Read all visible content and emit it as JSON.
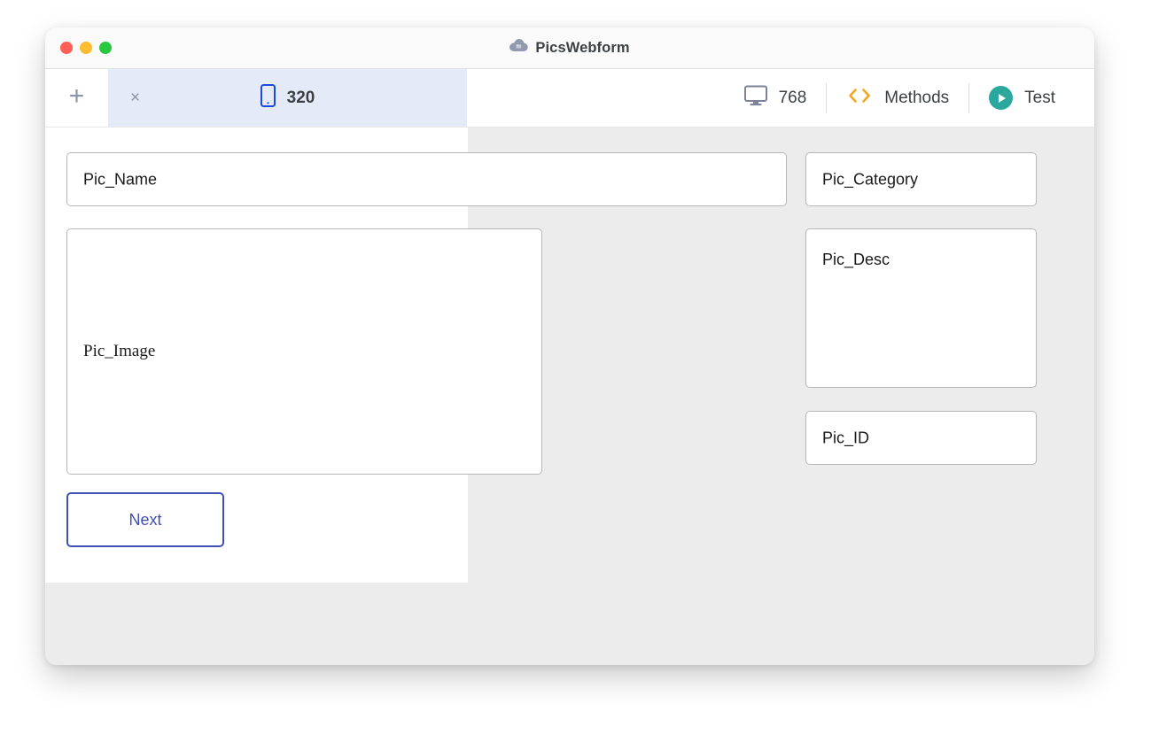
{
  "window": {
    "title": "PicsWebform",
    "title_icon": "cloud-icon",
    "traffic_lights": [
      {
        "name": "close",
        "color": "#ff5f57"
      },
      {
        "name": "minimize",
        "color": "#febc2e"
      },
      {
        "name": "zoom",
        "color": "#28c840"
      }
    ]
  },
  "toolbar": {
    "add_label": "+",
    "add_icon": "plus-icon",
    "tab": {
      "close_label": "×",
      "close_icon": "close-icon",
      "device_icon": "mobile-phone-icon",
      "device_icon_color": "#1a4ae0",
      "size_label": "320",
      "active": true,
      "background": "#e4eaf8"
    },
    "desktop": {
      "icon": "desktop-monitor-icon",
      "icon_color": "#7b8396",
      "size_label": "768"
    },
    "methods": {
      "icon": "code-brackets-icon",
      "icon_color": "#f5a623",
      "label": "Methods"
    },
    "test": {
      "icon": "play-circle-icon",
      "icon_color": "#2ba89e",
      "label": "Test"
    }
  },
  "canvas": {
    "viewport_background": "#ffffff",
    "page_background": "#ececec",
    "fields": [
      {
        "id": "f-name",
        "label": "Pic_Name",
        "type": "text",
        "font": "sans"
      },
      {
        "id": "f-image",
        "label": "Pic_Image",
        "type": "textarea",
        "font": "serif"
      },
      {
        "id": "f-category",
        "label": "Pic_Category",
        "type": "text",
        "font": "sans"
      },
      {
        "id": "f-desc",
        "label": "Pic_Desc",
        "type": "textarea",
        "font": "sans"
      },
      {
        "id": "f-id",
        "label": "Pic_ID",
        "type": "text",
        "font": "sans"
      }
    ],
    "next_button": {
      "label": "Next",
      "border_color": "#3f51b5",
      "text_color": "#3f51b5"
    }
  }
}
